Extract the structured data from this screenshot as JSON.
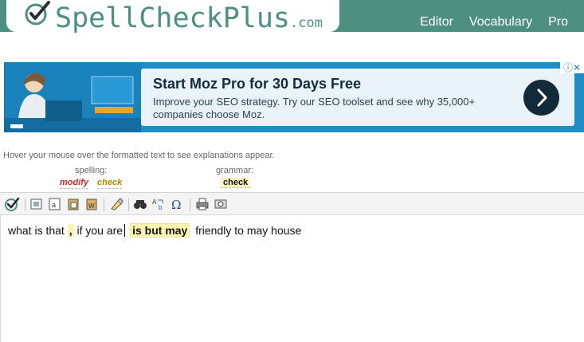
{
  "header": {
    "logo_text": "SpellCheckPlus",
    "logo_suffix": ".com",
    "nav": [
      "Editor",
      "Vocabulary",
      "Pro"
    ]
  },
  "ad": {
    "title": "Start Moz Pro for 30 Days Free",
    "body": "Improve your SEO strategy. Try our SEO toolset and see why 35,000+ companies choose Moz.",
    "choices_glyph": "ⓘ✕"
  },
  "hint": "Hover your mouse over the formatted text to see explanations appear.",
  "legend": {
    "spelling_label": "spelling:",
    "spelling_tags": [
      "modify",
      "check"
    ],
    "grammar_label": "grammar:",
    "grammar_tag": "check"
  },
  "editor": {
    "segment_1": "what is that",
    "comma": ",",
    "segment_2": "if you are",
    "grammar_phrase": "is but may",
    "segment_3": "friendly to may house"
  },
  "colors": {
    "brand": "#4d8f80",
    "highlight": "#fff3b0"
  },
  "toolbar_icons": [
    "check-icon",
    "cut-icon",
    "copy-icon",
    "paste-icon",
    "paste-special-icon",
    "clear-icon",
    "find-icon",
    "replace-icon",
    "omega-icon",
    "print-icon",
    "preview-icon"
  ]
}
